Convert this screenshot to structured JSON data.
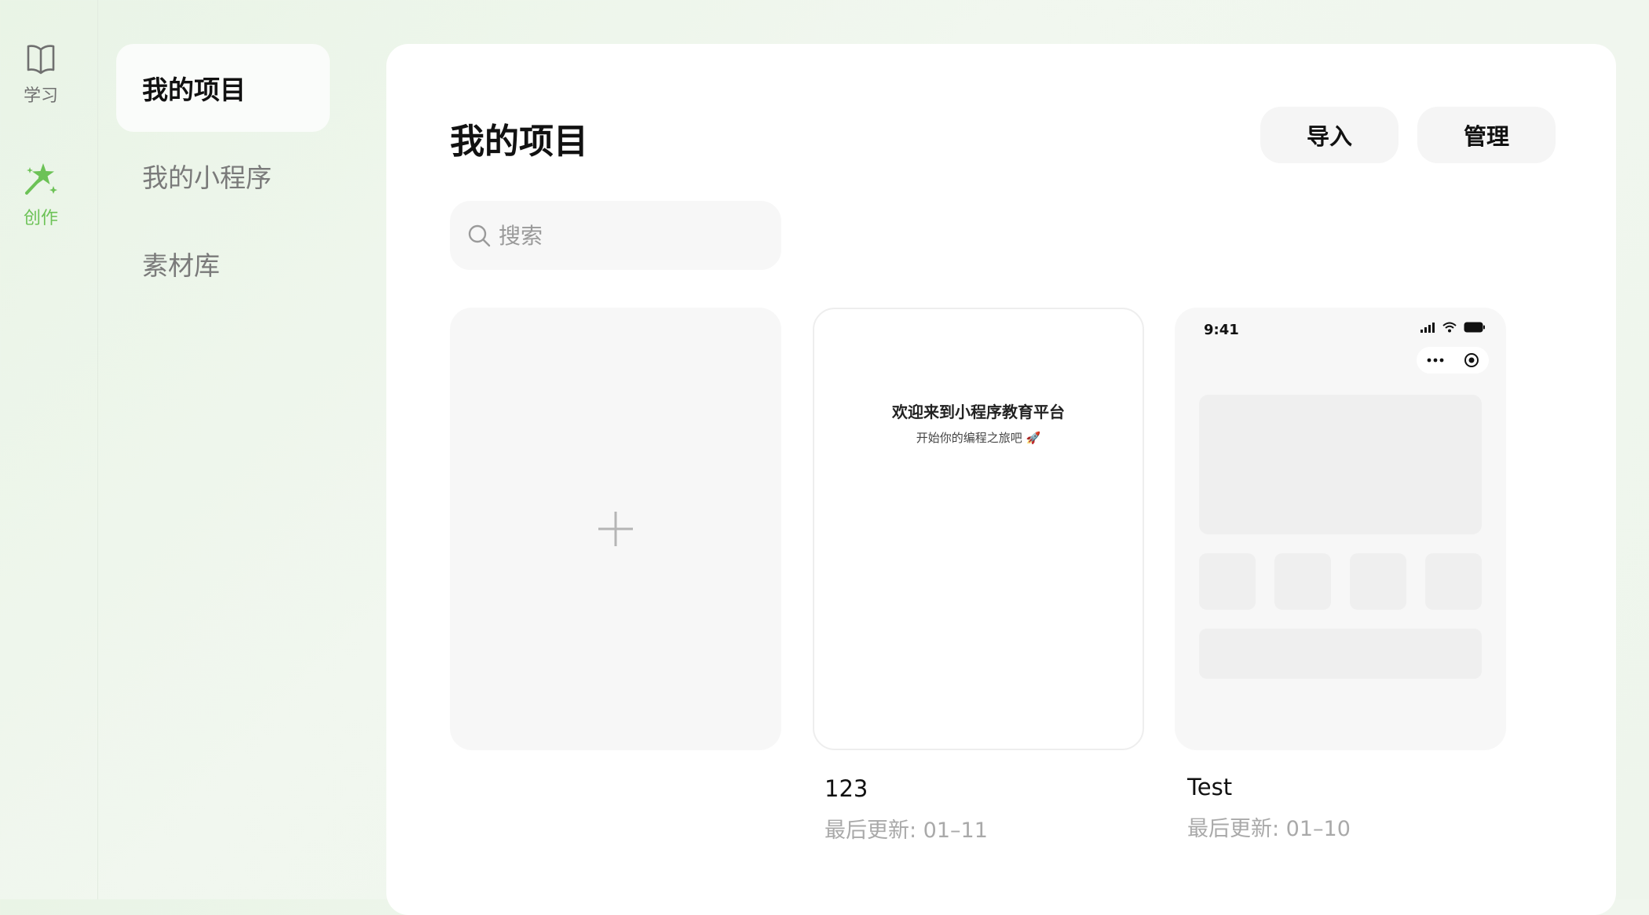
{
  "rail": {
    "items": [
      {
        "label": "学习",
        "icon": "book-icon",
        "color": "#707070"
      },
      {
        "label": "创作",
        "icon": "magic-wand-icon",
        "color": "#6cc256",
        "active": true
      }
    ]
  },
  "subnav": {
    "items": [
      {
        "label": "我的项目",
        "active": true
      },
      {
        "label": "我的小程序"
      },
      {
        "label": "素材库"
      }
    ]
  },
  "main": {
    "title": "我的项目",
    "import_label": "导入",
    "manage_label": "管理",
    "search": {
      "placeholder": "搜索",
      "value": ""
    },
    "projects": [
      {
        "name": "123",
        "updated": "最后更新: 01–11",
        "preview": {
          "title": "欢迎来到小程序教育平台",
          "subtitle": "开始你的编程之旅吧 🚀"
        }
      },
      {
        "name": "Test",
        "updated": "最后更新: 01–10",
        "preview": {
          "status_time": "9:41"
        }
      }
    ]
  },
  "colors": {
    "accent": "#6cc256",
    "card_bg": "#f7f7f7"
  }
}
